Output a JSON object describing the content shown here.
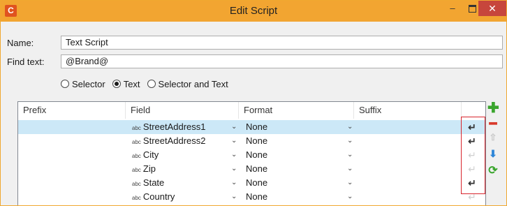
{
  "window": {
    "title": "Edit Script",
    "app_icon_letter": "C",
    "minimize": "–",
    "close": "✕"
  },
  "form": {
    "name_label": "Name:",
    "name_value": "Text Script",
    "find_label": "Find text:",
    "find_value": "@Brand@"
  },
  "mode": {
    "options": [
      {
        "label": "Selector",
        "selected": false
      },
      {
        "label": "Text",
        "selected": true
      },
      {
        "label": "Selector and Text",
        "selected": false
      }
    ]
  },
  "grid": {
    "columns": [
      "Prefix",
      "Field",
      "Format",
      "Suffix"
    ],
    "type_prefix": "abc",
    "rows": [
      {
        "prefix": "",
        "field": "StreetAddress1",
        "format": "None",
        "suffix": "",
        "newline": true,
        "selected": true
      },
      {
        "prefix": "",
        "field": "StreetAddress2",
        "format": "None",
        "suffix": "",
        "newline": true,
        "selected": false
      },
      {
        "prefix": "",
        "field": "City",
        "format": "None",
        "suffix": "",
        "newline": false,
        "selected": false
      },
      {
        "prefix": "",
        "field": "Zip",
        "format": "None",
        "suffix": "",
        "newline": false,
        "selected": false
      },
      {
        "prefix": "",
        "field": "State",
        "format": "None",
        "suffix": "",
        "newline": true,
        "selected": false
      },
      {
        "prefix": "",
        "field": "Country",
        "format": "None",
        "suffix": "",
        "newline": false,
        "selected": false
      }
    ]
  },
  "toolbar": {
    "add": "✚",
    "remove": "━",
    "up": "⇧",
    "down": "⬇",
    "refresh": "⟳"
  },
  "icons": {
    "newline": "↵",
    "dropdown": "⌄"
  },
  "colors": {
    "title_bar": "#f2a531",
    "close": "#c7463c",
    "selection": "#cce8f7",
    "highlight_box": "#d8242c"
  }
}
